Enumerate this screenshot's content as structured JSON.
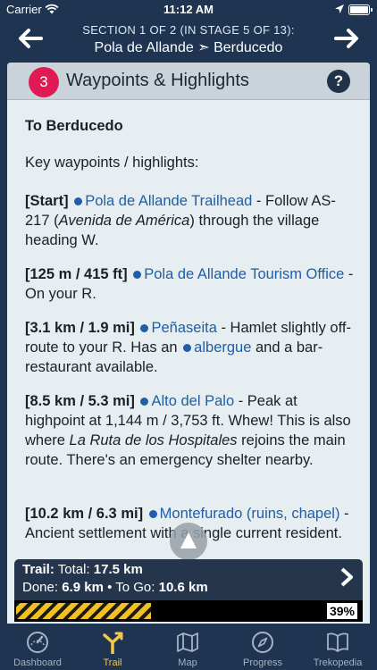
{
  "status_bar": {
    "carrier": "Carrier",
    "time": "11:12 AM"
  },
  "header": {
    "section": "SECTION 1 OF 2 (IN STAGE 5 OF 13):",
    "route_from": "Pola de Allande",
    "route_sep": "➣",
    "route_to": "Berducedo"
  },
  "card": {
    "badge": "3",
    "title": "Waypoints & Highlights",
    "help": "?",
    "heading": "To Berducedo",
    "intro": "Key waypoints / highlights:"
  },
  "waypoints": [
    {
      "dist": "[Start]",
      "link": "Pola de Allande Trailhead",
      "pre": " - Follow AS-217 (",
      "em": "Avenida de América",
      "post": ") through the village heading W."
    },
    {
      "dist": "[125 m / 415 ft]",
      "link": "Pola de Allande Tourism Office",
      "post": " - On your R."
    },
    {
      "dist": "[3.1 km / 1.9 mi]",
      "link": "Peñaseita",
      "pre": " - Hamlet slightly off-route to your R. Has an ",
      "link2": "albergue",
      "post": " and a bar-restaurant available."
    },
    {
      "dist": "[8.5 km / 5.3 mi]",
      "link": "Alto del Palo",
      "pre": " - Peak at highpoint at 1,144 m / 3,753 ft. Whew! This is also where ",
      "em": "La Ruta de los Hospitales",
      "post": " rejoins the main route. There's an emergency shelter nearby."
    },
    {
      "dist": "[10.2 km / 6.3 mi]",
      "link": "Montefurado (ruins, chapel)",
      "post": " - Ancient settlement with a single current resident."
    }
  ],
  "trail": {
    "total_label": "Trail:",
    "total_pre": "Total:",
    "total_value": "17.5 km",
    "done_label": "Done:",
    "done_value": "6.9 km",
    "sep": "•",
    "togo_label": "To Go:",
    "togo_value": "10.6 km",
    "percent_text": "39%",
    "percent": 0.39
  },
  "tabs": [
    {
      "label": "Dashboard",
      "icon": "dashboard-gauge-icon",
      "active": false
    },
    {
      "label": "Trail",
      "icon": "trail-fork-icon",
      "active": true
    },
    {
      "label": "Map",
      "icon": "map-icon",
      "active": false
    },
    {
      "label": "Progress",
      "icon": "compass-icon",
      "active": false
    },
    {
      "label": "Trekopedia",
      "icon": "book-icon",
      "active": false
    }
  ],
  "colors": {
    "accent": "#f2c94c",
    "badge": "#e01a55",
    "link": "#1f5ea8",
    "navy": "#1e3451"
  }
}
